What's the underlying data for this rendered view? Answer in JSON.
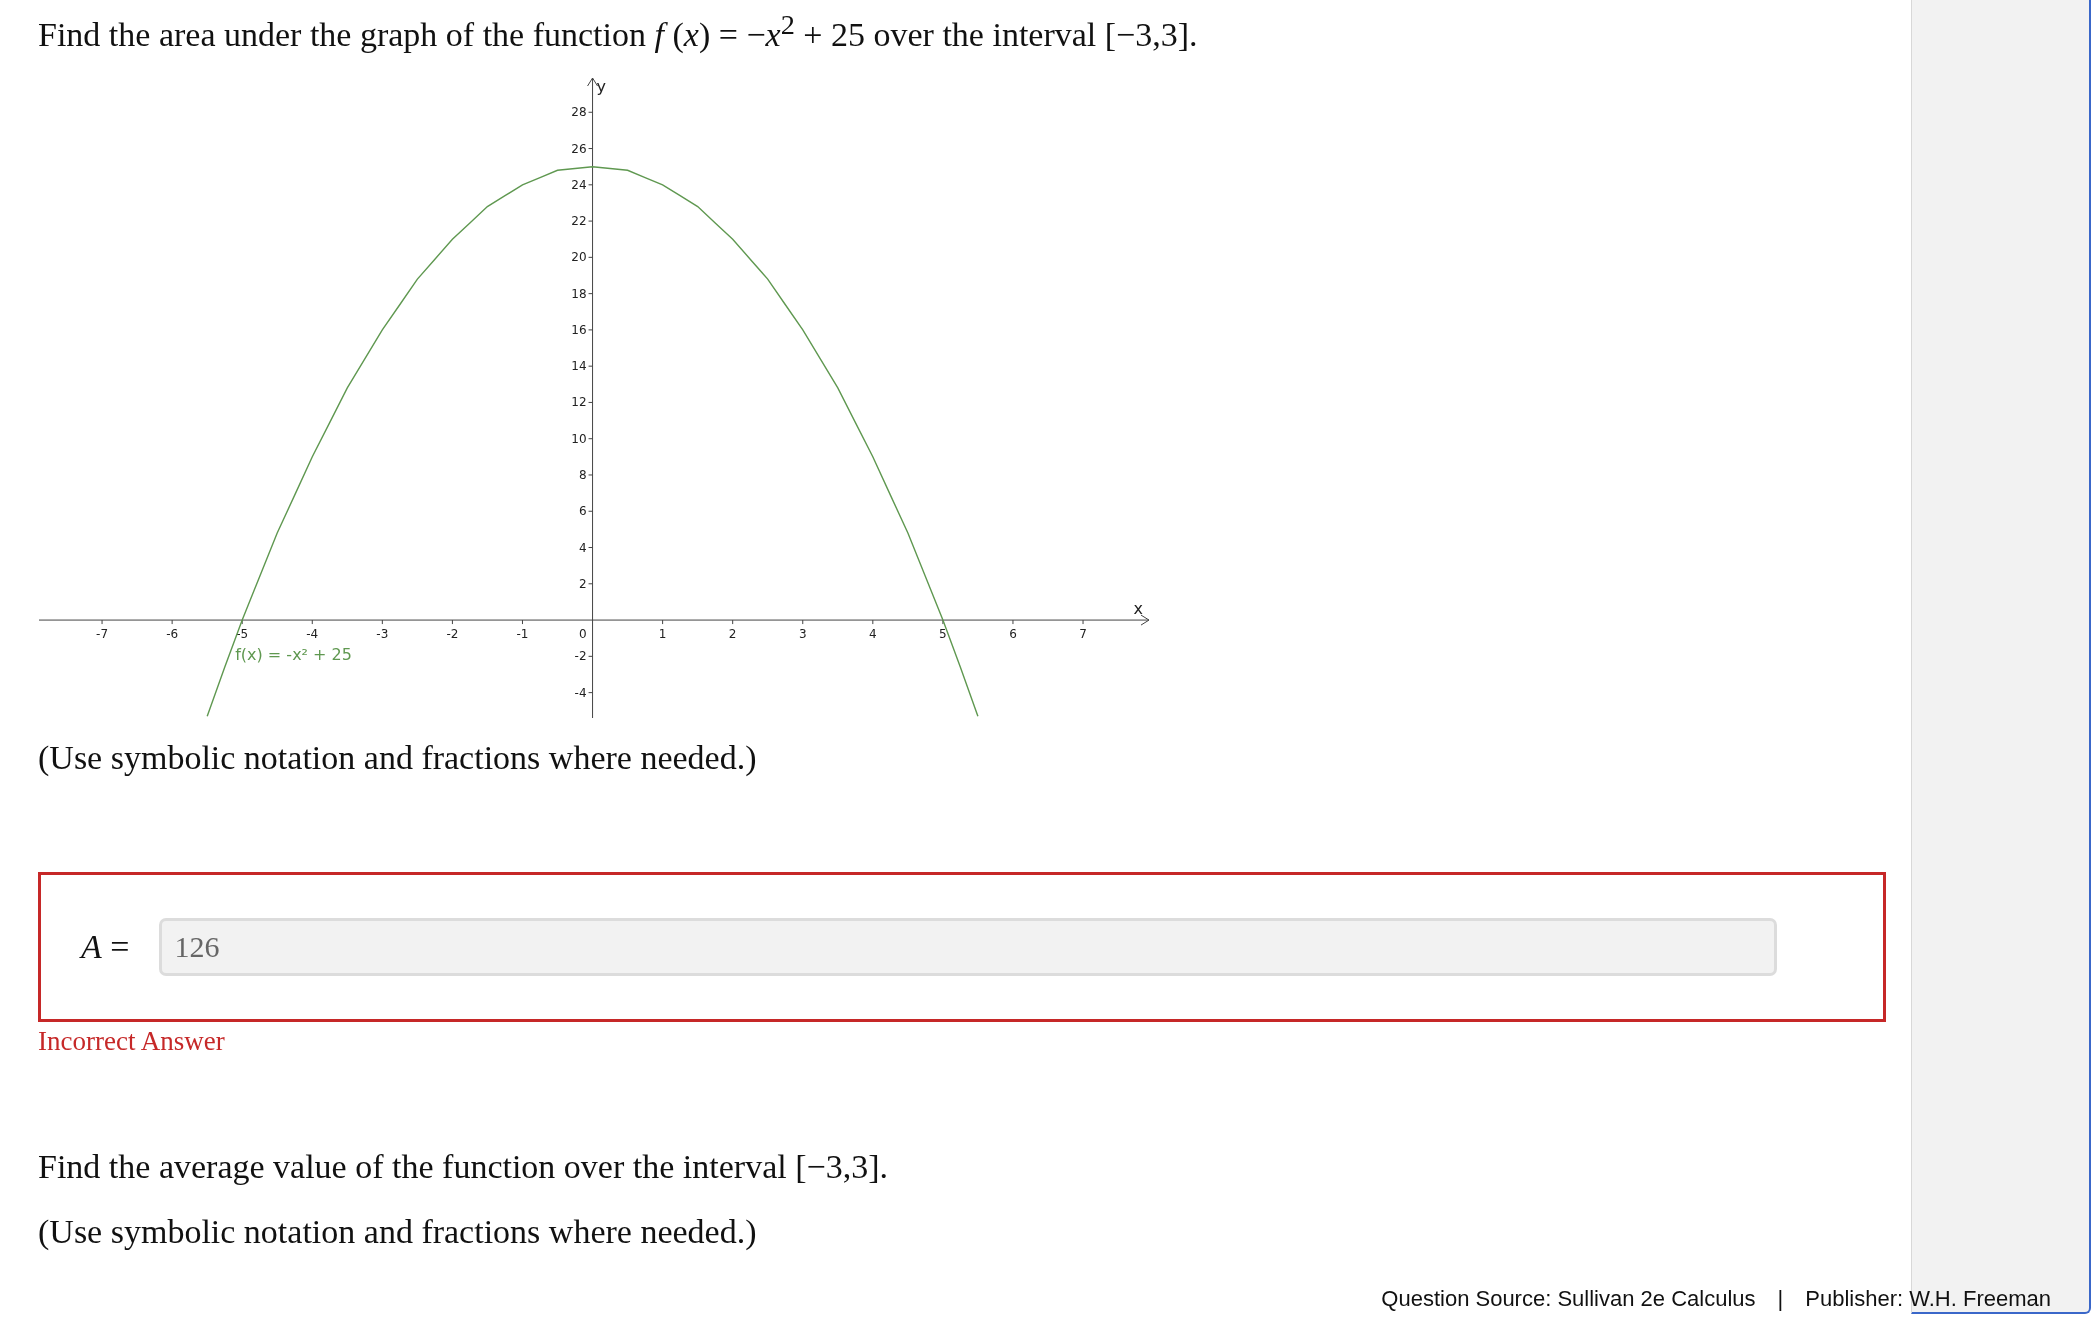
{
  "question": {
    "prompt": "Find the area under the graph of the function *f* (*x*) = −*x*$^{2}$ + 25 over the interval [−3,3].",
    "graph": {
      "chart_data": {
        "type": "line",
        "xlabel": "x",
        "ylabel": "y",
        "x": [
          -5.5,
          -5.25,
          -5,
          -4.75,
          -4.5,
          -4.25,
          -4,
          -3.75,
          -3.5,
          -3.25,
          -3,
          -2.75,
          -2.5,
          -2.25,
          -2,
          -1.75,
          -1.5,
          -1.25,
          -1,
          -0.75,
          -0.5,
          -0.25,
          0,
          0.25,
          0.5,
          0.75,
          1,
          1.25,
          1.5,
          1.75,
          2,
          2.25,
          2.5,
          2.75,
          3,
          3.25,
          3.5,
          3.75,
          4,
          4.25,
          4.5,
          4.75,
          5,
          5.25,
          5.5
        ],
        "series": [
          {
            "name": "f(x) = -x² + 25",
            "color": "#5f9850",
            "values": [
              -5.3,
              -2.6,
              0,
              2.4,
              4.8,
              6.9,
              9,
              10.9,
              12.8,
              14.4,
              16,
              17.4,
              18.8,
              19.9,
              21,
              21.9,
              22.8,
              23.4,
              24,
              24.4,
              24.8,
              24.9,
              25,
              24.9,
              24.8,
              24.4,
              24,
              23.4,
              22.8,
              21.9,
              21,
              19.9,
              18.8,
              17.4,
              16,
              14.4,
              12.8,
              10.9,
              9,
              6.9,
              4.8,
              2.4,
              0,
              -2.6,
              -5.3
            ]
          }
        ],
        "xlim": [
          -7.9,
          7.97
        ],
        "ylim": [
          -5.4,
          30
        ],
        "xticks": [
          -7,
          -6,
          -5,
          -4,
          -3,
          -2,
          -1,
          1,
          2,
          3,
          4,
          5,
          6,
          7
        ],
        "yticks": [
          -4,
          -2,
          2,
          4,
          6,
          8,
          10,
          12,
          14,
          16,
          18,
          20,
          22,
          24,
          26,
          28
        ]
      },
      "origin_label": "0"
    },
    "hint": "(Use symbolic notation and fractions where needed.)"
  },
  "answer": {
    "label": "*A* =",
    "value": "126",
    "correct": false,
    "feedback": "Incorrect Answer"
  },
  "question_2": {
    "prompt": "Find the average value of the function over the interval [−3,3].",
    "hint": "(Use symbolic notation and fractions where needed.)"
  },
  "footer": {
    "source": "Question Source: Sullivan 2e Calculus",
    "separator": "|",
    "publisher": "Publisher: W.H. Freeman"
  }
}
